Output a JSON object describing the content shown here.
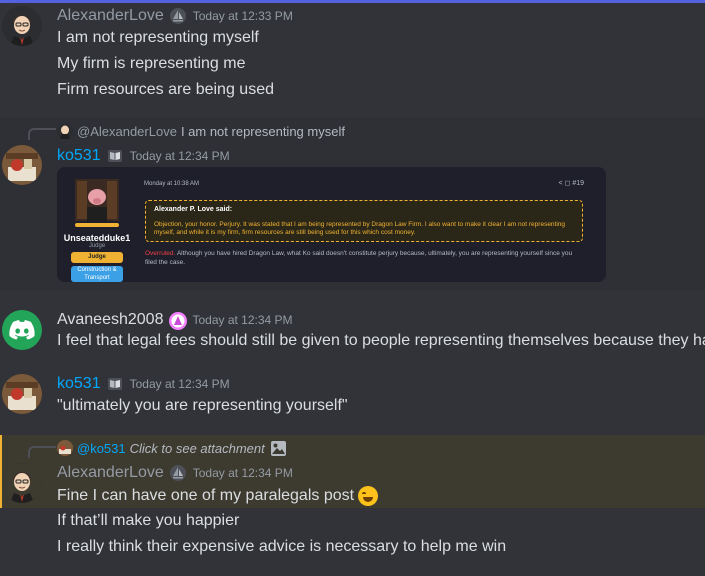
{
  "messages": [
    {
      "user": "AlexanderLove",
      "timestamp": "Today at 12:33 PM",
      "lines": [
        "I am not representing myself",
        "My firm is representing me",
        "Firm resources are being used"
      ]
    },
    {
      "reply": {
        "name": "@AlexanderLove",
        "text": "I am not representing myself"
      },
      "user": "ko531",
      "timestamp": "Today at 12:34 PM",
      "embed": {
        "judge_name": "Unseatedduke1",
        "judge_role": "Judge",
        "judge_button": "Judge",
        "construction_button_line1": "Construction &",
        "construction_button_line2": "Transport",
        "date": "Monday at 10:38 AM",
        "actions": "< ◻ #19",
        "quote_name": "Alexander P. Love said:",
        "quote_text": "Objection, your honor. Perjury. It was stated that I am being represented by Dragon Law Firm. I also want to make it clear I am not representing myself, and while it is my firm, firm resources are still being used for this which cost money.",
        "ruling_label": "Overruled.",
        "ruling_text": "Although you have hired Dragon Law, what Ko said doesn't constitute perjury because, ultimately, you are representing yourself since you filed the case."
      }
    },
    {
      "user": "Avaneesh2008",
      "timestamp": "Today at 12:34 PM",
      "lines": [
        "I feel that legal fees should still be given to people representing themselves because they had to"
      ]
    },
    {
      "user": "ko531",
      "timestamp": "Today at 12:34 PM",
      "lines": [
        "\"ultimately you are representing yourself\""
      ]
    },
    {
      "reply": {
        "name": "@ko531",
        "text": "Click to see attachment"
      },
      "user": "AlexanderLove",
      "timestamp": "Today at 12:34 PM",
      "lines": [
        "Fine I can have one of my paralegals post",
        "If that’ll make you happier",
        "I really think their expensive advice is necessary to help me win"
      ]
    }
  ],
  "icons": {
    "alex_badge": "sailboat-badge-icon",
    "ko_badge": "book-badge-icon",
    "av_badge": "pink-badge-icon",
    "attachment": "image-icon",
    "emoji": "grinning-sweat-emoji"
  },
  "colors": {
    "background": "#313338",
    "accent_blue": "#00a8fc",
    "mention_highlight": "#3d3a30",
    "mention_border": "#f0b232",
    "discord_green": "#23a559"
  }
}
